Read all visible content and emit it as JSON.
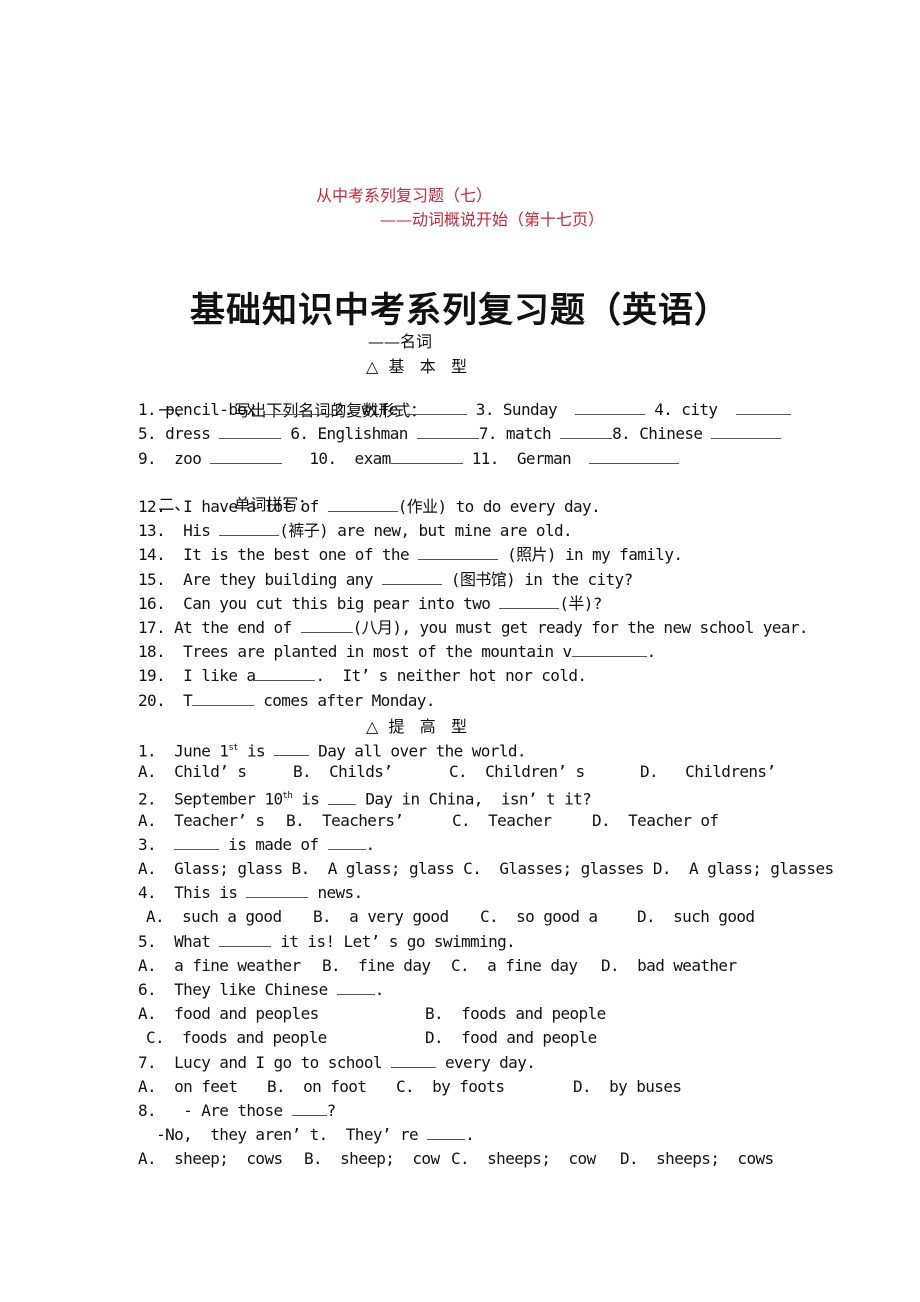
{
  "header": {
    "red_line1": "从中考系列复习题（七）",
    "red_line2": "——动词概说开始（第十七页）",
    "title": "基础知识中考系列复习题（英语）",
    "subtitle": "——名词",
    "section_basic": "△  基   本   型",
    "section_advanced": "△  提   高   型"
  },
  "part1": {
    "heading_num": "一、",
    "heading": "写出下列名词的复数形式：",
    "rows": [
      [
        "1. pencil-box ",
        "2. wife ",
        "3. Sunday  ",
        "4. city  "
      ],
      [
        "5. dress ",
        "6. Englishman ",
        "7. match ",
        "8. Chinese "
      ],
      [
        "9.  zoo ",
        "10.  exam",
        "11.  German  "
      ]
    ]
  },
  "part2": {
    "heading_num": "二、",
    "heading": "单词拼写：",
    "items": [
      {
        "pre": "12.  I have a lot of ",
        "post": "(作业) to do every day."
      },
      {
        "pre": "13.  His ",
        "post": "(裤子) are new, but mine are old."
      },
      {
        "pre": "14.  It is the best one of the ",
        "post": " (照片) in my family."
      },
      {
        "pre": "15.  Are they building any ",
        "post": " (图书馆) in the city?"
      },
      {
        "pre": "16.  Can you cut this big pear into two ",
        "post": "(半)?"
      },
      {
        "pre": "17. At the end of ",
        "post": "(八月), you must get ready for the new school year."
      },
      {
        "pre": "18.  Trees are planted in most of the mountain v",
        "post": "."
      },
      {
        "pre": "19.  I like a",
        "post": ".  It’ s neither hot nor cold."
      },
      {
        "pre": "20.  T",
        "post": " comes after Monday."
      }
    ]
  },
  "part3": {
    "questions": [
      {
        "stem_pre": "1.  June 1",
        "sup": "st",
        "stem_mid": " is ",
        "stem_post": " Day all over the world.",
        "options": [
          "A.  Child’ s",
          "B.  Childs’",
          "C.  Children’ s",
          "D.   Childrens’"
        ]
      },
      {
        "stem_pre": "2.  September 10",
        "sup": "th",
        "stem_mid": " is ",
        "stem_post": " Day in China,  isn’ t it?",
        "options": [
          "A.  Teacher’ s",
          "B.  Teachers’",
          "C.  Teacher",
          "D.  Teacher of"
        ]
      },
      {
        "stem_pre": "3.  ",
        "stem_mid": " is made of ",
        "stem_post": ".",
        "options": [
          "A.  Glass; glass B.  A glass; glass C.  Glasses; glasses D.  A glass; glasses"
        ]
      },
      {
        "stem_pre": "4.  This is ",
        "stem_post": " news.",
        "options": [
          "A.  such a good",
          "B.  a very good",
          "C.  so good a",
          "D.  such good"
        ]
      },
      {
        "stem_pre": "5.  What ",
        "stem_post": " it is! Let’ s go swimming.",
        "options": [
          "A.  a fine weather",
          "B.  fine day",
          "C.  a fine day",
          "D.  bad weather"
        ]
      },
      {
        "stem_pre": "6.  They like Chinese ",
        "stem_post": ".",
        "options": [
          "A.  food and peoples",
          "B.  foods and people",
          "C.  foods and people",
          "D.  food and people"
        ]
      },
      {
        "stem_pre": "7.  Lucy and I go to school ",
        "stem_post": " every day.",
        "options": [
          "A.  on feet",
          "B.  on foot",
          "C.  by foots",
          "D.  by buses"
        ]
      },
      {
        "stem_pre": "8.   - Are those ",
        "stem_post": "?",
        "stem2_pre": "  -No,  they aren’ t.  They’ re ",
        "stem2_post": ".",
        "options": [
          "A.  sheep;  cows",
          "B.  sheep;  cow",
          "C.  sheeps;  cow",
          "D.  sheeps;  cows"
        ]
      }
    ]
  }
}
